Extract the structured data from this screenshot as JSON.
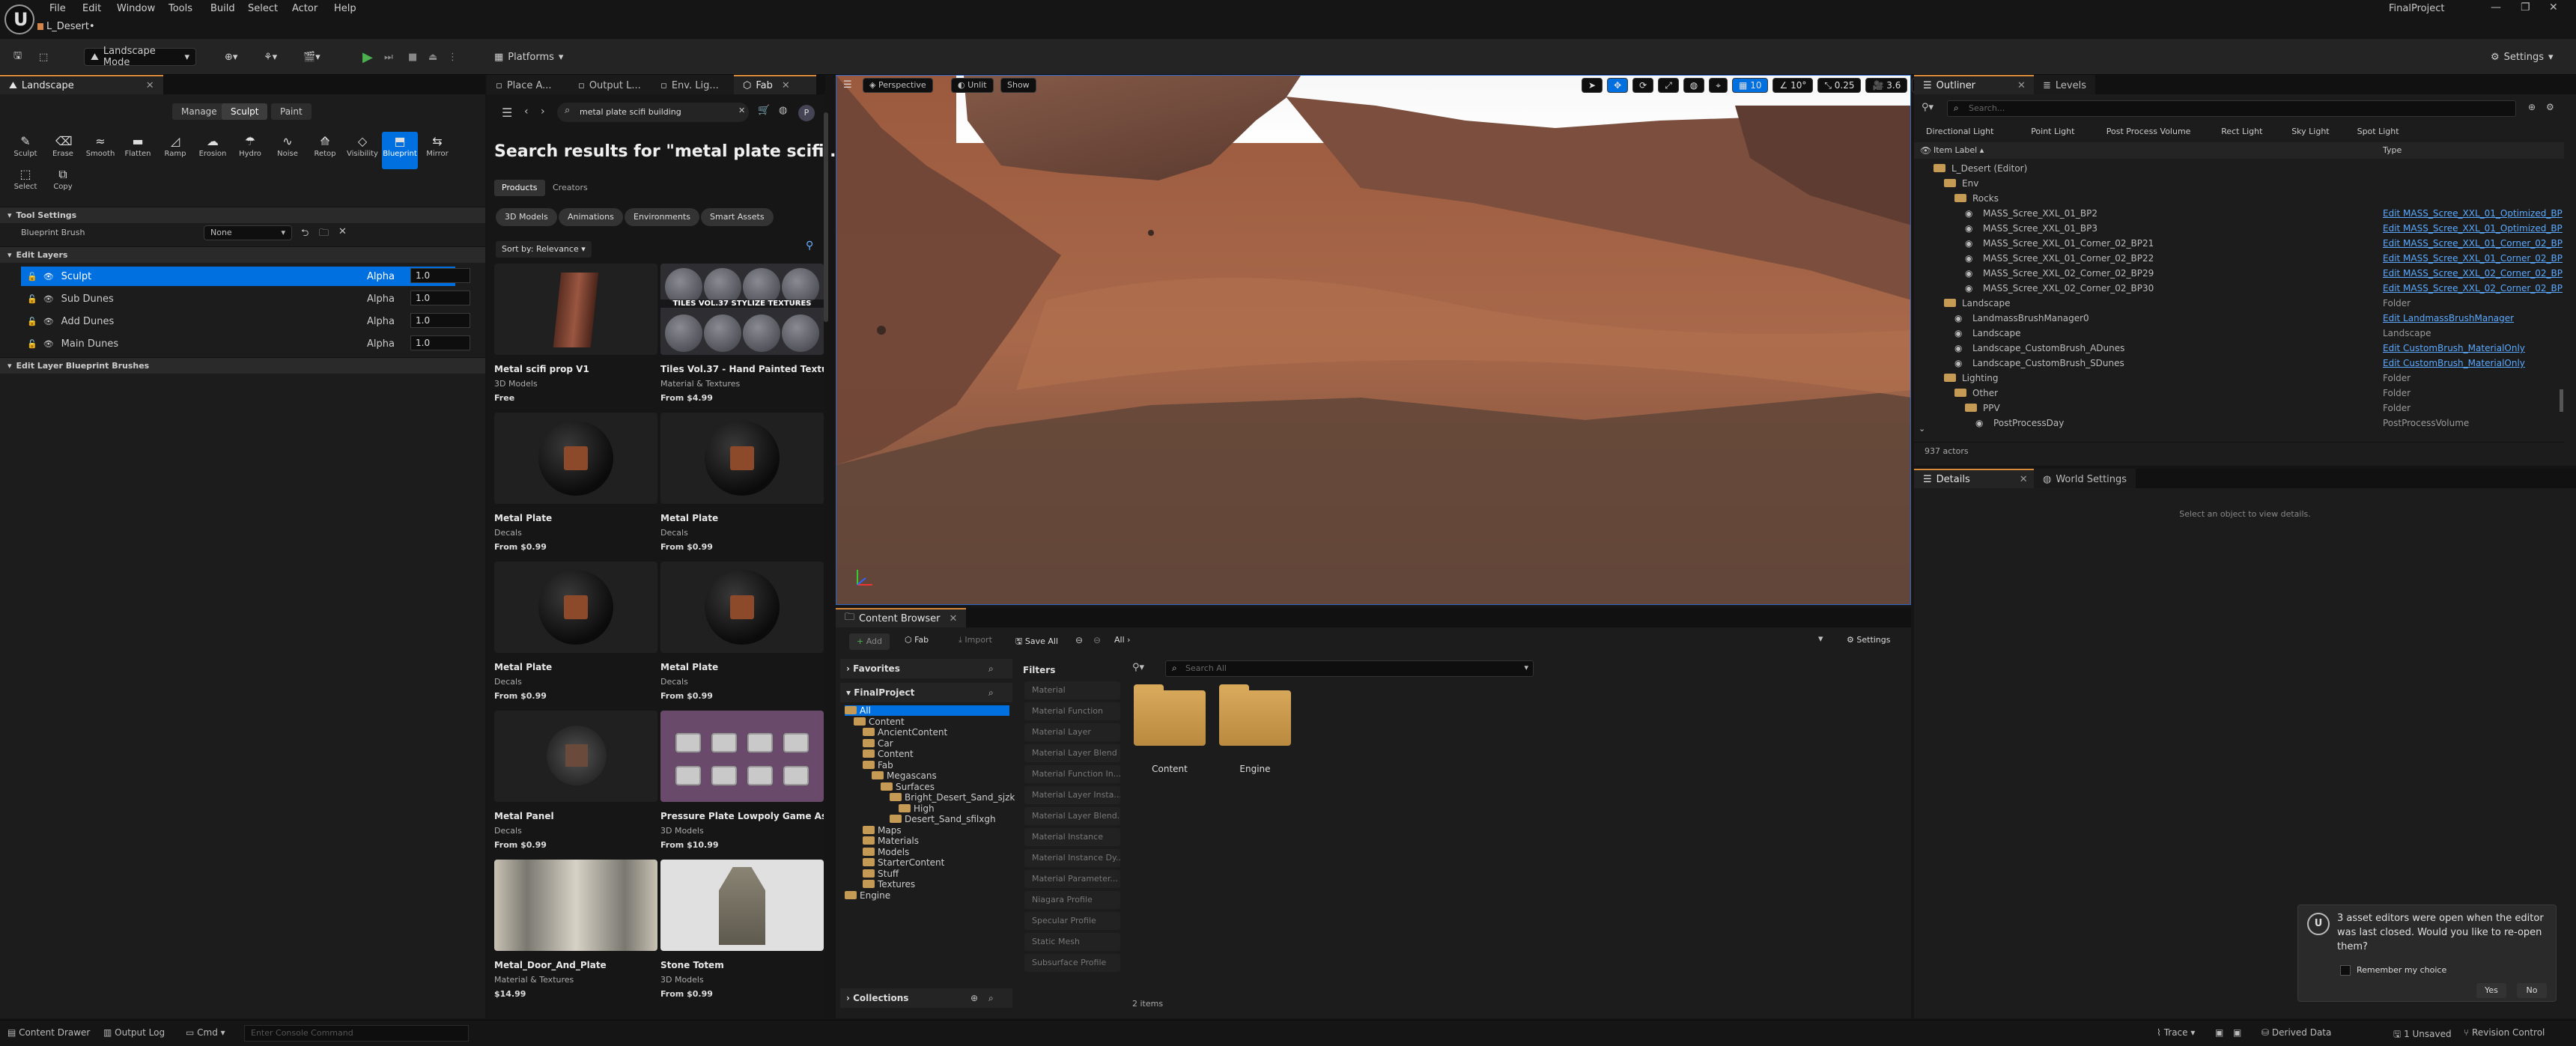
{
  "app": {
    "menu": [
      "File",
      "Edit",
      "Window",
      "Tools",
      "Build",
      "Select",
      "Actor",
      "Help"
    ],
    "level": "L_Desert•",
    "project": "FinalProject"
  },
  "toolbar": {
    "mode": "Landscape Mode",
    "platforms": "Platforms",
    "settings": "Settings"
  },
  "landscape": {
    "tab": "Landscape",
    "modes": [
      "Manage",
      "Sculpt",
      "Paint"
    ],
    "tools": [
      {
        "label": "Sculpt",
        "icon": "sculpt-icon"
      },
      {
        "label": "Erase",
        "icon": "erase-icon"
      },
      {
        "label": "Smooth",
        "icon": "smooth-icon"
      },
      {
        "label": "Flatten",
        "icon": "flatten-icon"
      },
      {
        "label": "Ramp",
        "icon": "ramp-icon"
      },
      {
        "label": "Erosion",
        "icon": "erosion-icon"
      },
      {
        "label": "Hydro",
        "icon": "hydro-icon"
      },
      {
        "label": "Noise",
        "icon": "noise-icon"
      },
      {
        "label": "Retop",
        "icon": "retop-icon"
      },
      {
        "label": "Visibility",
        "icon": "visibility-icon"
      },
      {
        "label": "Blueprint",
        "icon": "blueprint-icon"
      },
      {
        "label": "Mirror",
        "icon": "mirror-icon"
      }
    ],
    "tools2": [
      {
        "label": "Select",
        "icon": "select-icon"
      },
      {
        "label": "Copy",
        "icon": "copy-icon"
      }
    ],
    "tool_settings": "Tool Settings",
    "bp_brush_label": "Blueprint Brush",
    "bp_brush_value": "None",
    "edit_layers": "Edit Layers",
    "layers": [
      {
        "name": "Sculpt",
        "alpha_label": "Alpha",
        "alpha": "1.0"
      },
      {
        "name": "Sub Dunes",
        "alpha_label": "Alpha",
        "alpha": "1.0"
      },
      {
        "name": "Add Dunes",
        "alpha_label": "Alpha",
        "alpha": "1.0"
      },
      {
        "name": "Main Dunes",
        "alpha_label": "Alpha",
        "alpha": "1.0"
      }
    ],
    "edit_layer_bp": "Edit Layer Blueprint Brushes"
  },
  "fab": {
    "tabs": [
      "Place A...",
      "Output L...",
      "Env. Lig...",
      "Fab"
    ],
    "search": "metal plate scifi building",
    "title": "Search results for \"metal plate scifi ...",
    "subtabs": [
      "Products",
      "Creators"
    ],
    "filters": [
      "3D Models",
      "Animations",
      "Environments",
      "Smart Assets"
    ],
    "sort": "Sort by: Relevance",
    "cards": [
      {
        "title": "Metal scifi prop V1",
        "cat": "3D Models",
        "price": "Free"
      },
      {
        "title": "Tiles Vol.37 - Hand Painted Textu...",
        "cat": "Material & Textures",
        "price": "From $4.99"
      },
      {
        "title": "Metal Plate",
        "cat": "Decals",
        "price": "From $0.99"
      },
      {
        "title": "Metal Plate",
        "cat": "Decals",
        "price": "From $0.99"
      },
      {
        "title": "Metal Plate",
        "cat": "Decals",
        "price": "From $0.99"
      },
      {
        "title": "Metal Plate",
        "cat": "Decals",
        "price": "From $0.99"
      },
      {
        "title": "Metal Panel",
        "cat": "Decals",
        "price": "From $0.99"
      },
      {
        "title": "Pressure Plate Lowpoly Game As...",
        "cat": "3D Models",
        "price": "From $10.99"
      },
      {
        "title": "Metal_Door_And_Plate",
        "cat": "Material & Textures",
        "price": "$14.99"
      },
      {
        "title": "Stone Totem",
        "cat": "3D Models",
        "price": "From $0.99"
      }
    ],
    "tiles_thumb_text": "TILES VOL.37 STYLIZE TEXTURES"
  },
  "viewport": {
    "perspective": "Perspective",
    "lit": "Unlit",
    "show": "Show",
    "grid": "10",
    "rot": "10°",
    "scale": "0.25",
    "cam": "3.6"
  },
  "content_browser": {
    "tab": "Content Browser",
    "add": "Add",
    "fab": "Fab",
    "import": "Import",
    "save_all": "Save All",
    "path": "All",
    "settings": "Settings",
    "favorites": "Favorites",
    "project": "FinalProject",
    "filters_label": "Filters",
    "search_placeholder": "Search All",
    "tree": [
      "All",
      "Content",
      "AncientContent",
      "Car",
      "Content",
      "Fab",
      "Megascans",
      "Surfaces",
      "Bright_Desert_Sand_sjzk",
      "High",
      "Desert_Sand_sfilxgh",
      "Maps",
      "Materials",
      "Models",
      "StarterContent",
      "Stuff",
      "Textures",
      "Engine"
    ],
    "filters": [
      "Material",
      "Material Function",
      "Material Layer",
      "Material Layer Blend",
      "Material Function In...",
      "Material Layer Insta...",
      "Material Layer Blend...",
      "Material Instance",
      "Material Instance Dy...",
      "Material Parameter...",
      "Niagara Profile",
      "Specular Profile",
      "Static Mesh",
      "Subsurface Profile"
    ],
    "folders": [
      "Content",
      "Engine"
    ],
    "count": "2 items",
    "collections": "Collections"
  },
  "outliner": {
    "tabs": [
      "Outliner",
      "Levels"
    ],
    "search_placeholder": "Search...",
    "lights": [
      "Directional Light",
      "Point Light",
      "Post Process Volume",
      "Rect Light",
      "Sky Light",
      "Spot Light"
    ],
    "col_label": "Item Label",
    "col_type": "Type",
    "rows": [
      {
        "name": "L_Desert (Editor)",
        "type": "",
        "link": false,
        "indent": 0
      },
      {
        "name": "Env",
        "type": "",
        "link": false,
        "indent": 1
      },
      {
        "name": "Rocks",
        "type": "",
        "link": false,
        "indent": 2
      },
      {
        "name": "MASS_Scree_XXL_01_BP2",
        "type": "Edit MASS_Scree_XXL_01_Optimized_BP",
        "link": true,
        "indent": 3
      },
      {
        "name": "MASS_Scree_XXL_01_BP3",
        "type": "Edit MASS_Scree_XXL_01_Optimized_BP",
        "link": true,
        "indent": 3
      },
      {
        "name": "MASS_Scree_XXL_01_Corner_02_BP21",
        "type": "Edit MASS_Scree_XXL_01_Corner_02_BP",
        "link": true,
        "indent": 3
      },
      {
        "name": "MASS_Scree_XXL_01_Corner_02_BP22",
        "type": "Edit MASS_Scree_XXL_01_Corner_02_BP",
        "link": true,
        "indent": 3
      },
      {
        "name": "MASS_Scree_XXL_02_Corner_02_BP29",
        "type": "Edit MASS_Scree_XXL_02_Corner_02_BP",
        "link": true,
        "indent": 3
      },
      {
        "name": "MASS_Scree_XXL_02_Corner_02_BP30",
        "type": "Edit MASS_Scree_XXL_02_Corner_02_BP",
        "link": true,
        "indent": 3
      },
      {
        "name": "Landscape",
        "type": "Folder",
        "link": false,
        "indent": 1
      },
      {
        "name": "LandmassBrushManager0",
        "type": "Edit LandmassBrushManager",
        "link": true,
        "indent": 2
      },
      {
        "name": "Landscape",
        "type": "Landscape",
        "link": false,
        "indent": 2
      },
      {
        "name": "Landscape_CustomBrush_ADunes",
        "type": "Edit CustomBrush_MaterialOnly",
        "link": true,
        "indent": 2
      },
      {
        "name": "Landscape_CustomBrush_SDunes",
        "type": "Edit CustomBrush_MaterialOnly",
        "link": true,
        "indent": 2
      },
      {
        "name": "Lighting",
        "type": "Folder",
        "link": false,
        "indent": 1
      },
      {
        "name": "Other",
        "type": "Folder",
        "link": false,
        "indent": 2
      },
      {
        "name": "PPV",
        "type": "Folder",
        "link": false,
        "indent": 3
      },
      {
        "name": "PostProcessDay",
        "type": "PostProcessVolume",
        "link": false,
        "indent": 4
      }
    ],
    "actors": "937 actors"
  },
  "details": {
    "tabs": [
      "Details",
      "World Settings"
    ],
    "empty": "Select an object to view details."
  },
  "toast": {
    "text": "3 asset editors were open when the editor was last closed. Would you like to re-open them?",
    "remember": "Remember my choice",
    "yes": "Yes",
    "no": "No"
  },
  "statusbar": {
    "content_drawer": "Content Drawer",
    "output_log": "Output Log",
    "cmd": "Cmd",
    "console_placeholder": "Enter Console Command",
    "trace": "Trace",
    "derived": "Derived Data",
    "unsaved": "1 Unsaved",
    "revision": "Revision Control"
  },
  "colors": {
    "accent": "#0070e0",
    "folder": "#c59a54",
    "tab_highlight": "#d68a3c"
  }
}
